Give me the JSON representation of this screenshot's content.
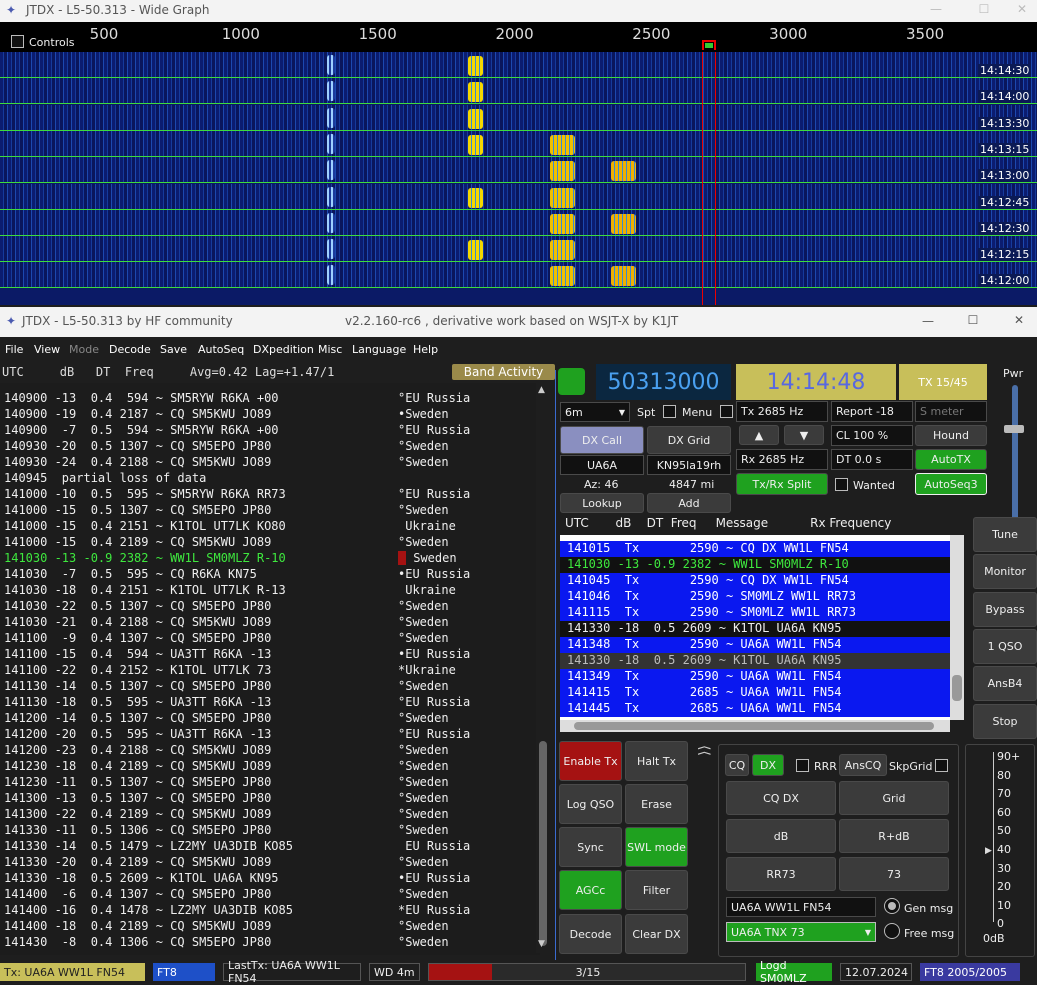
{
  "wide_graph": {
    "title": "JTDX - L5-50.313 - Wide Graph",
    "controls_label": "Controls",
    "scale": [
      {
        "label": "500",
        "hz": 500
      },
      {
        "label": "1000",
        "hz": 1000
      },
      {
        "label": "1500",
        "hz": 1500
      },
      {
        "label": "2000",
        "hz": 2000
      },
      {
        "label": "2500",
        "hz": 2500
      },
      {
        "label": "3000",
        "hz": 3000
      },
      {
        "label": "3500",
        "hz": 3500
      }
    ],
    "timestamps": [
      "14:14:30",
      "14:14:00",
      "14:13:30",
      "14:13:15",
      "14:13:00",
      "14:12:45",
      "14:12:30",
      "14:12:15",
      "14:12:00"
    ]
  },
  "main_window": {
    "title": "JTDX - L5-50.313  by HF community",
    "version_text": "v2.2.160-rc6 , derivative work based on WSJT-X by K1JT"
  },
  "menu": [
    "File",
    "View",
    "Mode",
    "Decode",
    "Save",
    "AutoSeq",
    "DXpedition",
    "Misc",
    "Language",
    "Help"
  ],
  "left_header": "UTC     dB   DT  Freq     Avg=0.42 Lag=+1.47/1",
  "band_activity_label": "Band Activity",
  "decodes": [
    {
      "t": "140900 -13  0.4  594 ~ SM5RYW R6KA +00",
      "c": "°EU Russia",
      "hl": false
    },
    {
      "t": "140900 -19  0.4 2187 ~ CQ SM5KWU JO89",
      "c": "•Sweden",
      "hl": false
    },
    {
      "t": "140900  -7  0.5  594 ~ SM5RYW R6KA +00",
      "c": "°EU Russia",
      "hl": false
    },
    {
      "t": "140930 -20  0.5 1307 ~ CQ SM5EPO JP80",
      "c": "°Sweden",
      "hl": false
    },
    {
      "t": "140930 -24  0.4 2188 ~ CQ SM5KWU JO89",
      "c": "°Sweden",
      "hl": false
    },
    {
      "t": "140945  partial loss of data",
      "c": "",
      "hl": false
    },
    {
      "t": "141000 -10  0.5  595 ~ SM5RYW R6KA RR73",
      "c": "°EU Russia",
      "hl": false
    },
    {
      "t": "141000 -15  0.5 1307 ~ CQ SM5EPO JP80",
      "c": "°Sweden",
      "hl": false
    },
    {
      "t": "141000 -15  0.4 2151 ~ K1TOL UT7LK KO80",
      "c": " Ukraine",
      "hl": false
    },
    {
      "t": "141000 -15  0.4 2189 ~ CQ SM5KWU JO89",
      "c": "°Sweden",
      "hl": false
    },
    {
      "t": "141030 -13 -0.9 2382 ~ WW1L SM0MLZ R-10",
      "c": " Sweden",
      "hl": true
    },
    {
      "t": "141030  -7  0.5  595 ~ CQ R6KA KN75",
      "c": "•EU Russia",
      "hl": false
    },
    {
      "t": "141030 -18  0.4 2151 ~ K1TOL UT7LK R-13",
      "c": " Ukraine",
      "hl": false
    },
    {
      "t": "141030 -22  0.5 1307 ~ CQ SM5EPO JP80",
      "c": "°Sweden",
      "hl": false
    },
    {
      "t": "141030 -21  0.4 2188 ~ CQ SM5KWU JO89",
      "c": "°Sweden",
      "hl": false
    },
    {
      "t": "141100  -9  0.4 1307 ~ CQ SM5EPO JP80",
      "c": "°Sweden",
      "hl": false
    },
    {
      "t": "141100 -15  0.4  594 ~ UA3TT R6KA -13",
      "c": "•EU Russia",
      "hl": false
    },
    {
      "t": "141100 -22  0.4 2152 ~ K1TOL UT7LK 73",
      "c": "*Ukraine",
      "hl": false
    },
    {
      "t": "141130 -14  0.5 1307 ~ CQ SM5EPO JP80",
      "c": "°Sweden",
      "hl": false
    },
    {
      "t": "141130 -18  0.5  595 ~ UA3TT R6KA -13",
      "c": "°EU Russia",
      "hl": false
    },
    {
      "t": "141200 -14  0.5 1307 ~ CQ SM5EPO JP80",
      "c": "°Sweden",
      "hl": false
    },
    {
      "t": "141200 -20  0.5  595 ~ UA3TT R6KA -13",
      "c": "°EU Russia",
      "hl": false
    },
    {
      "t": "141200 -23  0.4 2188 ~ CQ SM5KWU JO89",
      "c": "°Sweden",
      "hl": false
    },
    {
      "t": "141230 -18  0.4 2189 ~ CQ SM5KWU JO89",
      "c": "°Sweden",
      "hl": false
    },
    {
      "t": "141230 -11  0.5 1307 ~ CQ SM5EPO JP80",
      "c": "°Sweden",
      "hl": false
    },
    {
      "t": "141300 -13  0.5 1307 ~ CQ SM5EPO JP80",
      "c": "°Sweden",
      "hl": false
    },
    {
      "t": "141300 -22  0.4 2189 ~ CQ SM5KWU JO89",
      "c": "°Sweden",
      "hl": false
    },
    {
      "t": "141330 -11  0.5 1306 ~ CQ SM5EPO JP80",
      "c": "°Sweden",
      "hl": false
    },
    {
      "t": "141330 -14  0.5 1479 ~ LZ2MY UA3DIB KO85",
      "c": " EU Russia",
      "hl": false
    },
    {
      "t": "141330 -20  0.4 2189 ~ CQ SM5KWU JO89",
      "c": "°Sweden",
      "hl": false
    },
    {
      "t": "141330 -18  0.5 2609 ~ K1TOL UA6A KN95",
      "c": "•EU Russia",
      "hl": false
    },
    {
      "t": "141400  -6  0.4 1307 ~ CQ SM5EPO JP80",
      "c": "°Sweden",
      "hl": false
    },
    {
      "t": "141400 -16  0.4 1478 ~ LZ2MY UA3DIB KO85",
      "c": "*EU Russia",
      "hl": false
    },
    {
      "t": "141400 -18  0.4 2189 ~ CQ SM5KWU JO89",
      "c": "°Sweden",
      "hl": false
    },
    {
      "t": "141430  -8  0.4 1306 ~ CQ SM5EPO JP80",
      "c": "°Sweden",
      "hl": false
    }
  ],
  "freq_display": "50313000",
  "time_display": "14:14:48",
  "tx_counter": "TX 15/45",
  "pwr_label": "Pwr",
  "band": "6m",
  "spt_label": "Spt",
  "menu_check_label": "Menu",
  "tx_hz": "Tx  2685  Hz",
  "report": "Report -18",
  "smeter_placeholder": "S meter",
  "dx_call_btn": "DX Call",
  "dx_grid_btn": "DX Grid",
  "dx_call": "UA6A",
  "dx_grid": "KN95la19rh",
  "az": "Az: 46",
  "dist": "4847 mi",
  "lookup_btn": "Lookup",
  "add_btn": "Add",
  "cl": "CL  100 %",
  "hound_btn": "Hound",
  "rx_hz": "Rx  2685  Hz",
  "dt": "DT  0.0 s",
  "autotx_btn": "AutoTX",
  "split_btn": "Tx/Rx Split",
  "wanted_label": "Wanted",
  "autoseq3_btn": "AutoSeq3",
  "rx_header": "UTC       dB    DT  Freq     Message           Rx Frequency",
  "rx_rows": [
    {
      "t": "141015  Tx       2590 ~ CQ DX WW1L FN54",
      "s": "tx"
    },
    {
      "t": "141030 -13 -0.9 2382 ~ WW1L SM0MLZ R-10",
      "s": "rx"
    },
    {
      "t": "141045  Tx       2590 ~ CQ DX WW1L FN54",
      "s": "tx"
    },
    {
      "t": "141046  Tx       2590 ~ SM0MLZ WW1L RR73",
      "s": "tx"
    },
    {
      "t": "141115  Tx       2590 ~ SM0MLZ WW1L RR73",
      "s": "tx"
    },
    {
      "t": "141330 -18  0.5 2609 ~ K1TOL UA6A KN95",
      "s": "rx2"
    },
    {
      "t": "141348  Tx       2590 ~ UA6A WW1L FN54",
      "s": "tx"
    },
    {
      "t": "141330 -18  0.5 2609 ~ K1TOL UA6A KN95",
      "s": "rx3"
    },
    {
      "t": "141349  Tx       2590 ~ UA6A WW1L FN54",
      "s": "tx"
    },
    {
      "t": "141415  Tx       2685 ~ UA6A WW1L FN54",
      "s": "tx"
    },
    {
      "t": "141445  Tx       2685 ~ UA6A WW1L FN54",
      "s": "tx"
    }
  ],
  "side_btns": [
    "Tune",
    "Monitor",
    "Bypass",
    "1 QSO",
    "AnsB4",
    "Stop"
  ],
  "grid_btns": {
    "enable_tx": "Enable Tx",
    "halt_tx": "Halt Tx",
    "log_qso": "Log QSO",
    "erase": "Erase",
    "sync": "Sync",
    "swl_mode": "SWL mode",
    "agcc": "AGCc",
    "filter": "Filter",
    "decode": "Decode",
    "clear_dx": "Clear DX"
  },
  "cq_btn": "CQ",
  "dx_btn": "DX",
  "rrr_label": "RRR",
  "anscq_btn": "AnsCQ",
  "skpgrid_label": "SkpGrid",
  "msg_btns": [
    "CQ DX",
    "Grid",
    "dB",
    "R+dB",
    "RR73",
    "73"
  ],
  "gen_field": "UA6A WW1L FN54",
  "tnx_field": "UA6A TNX 73",
  "gen_msg_label": "Gen msg",
  "free_msg_label": "Free msg",
  "db_scale": [
    "90+",
    "80",
    "70",
    "60",
    "50",
    "40",
    "30",
    "20",
    "10",
    "0"
  ],
  "db_label": "0dB",
  "status": {
    "tx": "Tx: UA6A WW1L FN54",
    "mode": "FT8",
    "lasttx": "LastTx: UA6A WW1L FN54",
    "wd": "WD 4m",
    "progress": "3/15",
    "progress_fraction": 0.2,
    "logd": "Logd SM0MLZ",
    "date": "12.07.2024",
    "count": "FT8  2005/2005"
  }
}
